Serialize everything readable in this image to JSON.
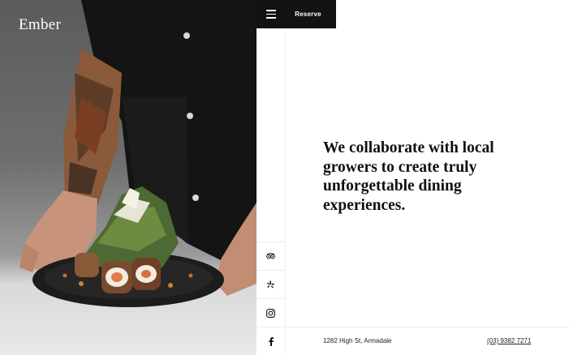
{
  "brand": {
    "logo_text": "Ember"
  },
  "header": {
    "menu_icon": "hamburger-menu-icon",
    "reserve_label": "Reserve"
  },
  "social": [
    {
      "name": "tripadvisor",
      "icon": "tripadvisor-icon"
    },
    {
      "name": "yelp",
      "icon": "yelp-icon"
    },
    {
      "name": "instagram",
      "icon": "instagram-icon"
    },
    {
      "name": "facebook",
      "icon": "facebook-icon"
    }
  ],
  "main": {
    "headline": "We collaborate with local growers to create truly unforgettable dining experiences."
  },
  "footer": {
    "address": "1282 High St, Armadale",
    "phone": "(03) 9382 7271"
  },
  "colors": {
    "topbar_bg": "#121212",
    "text": "#111111",
    "divider": "#ececec"
  }
}
